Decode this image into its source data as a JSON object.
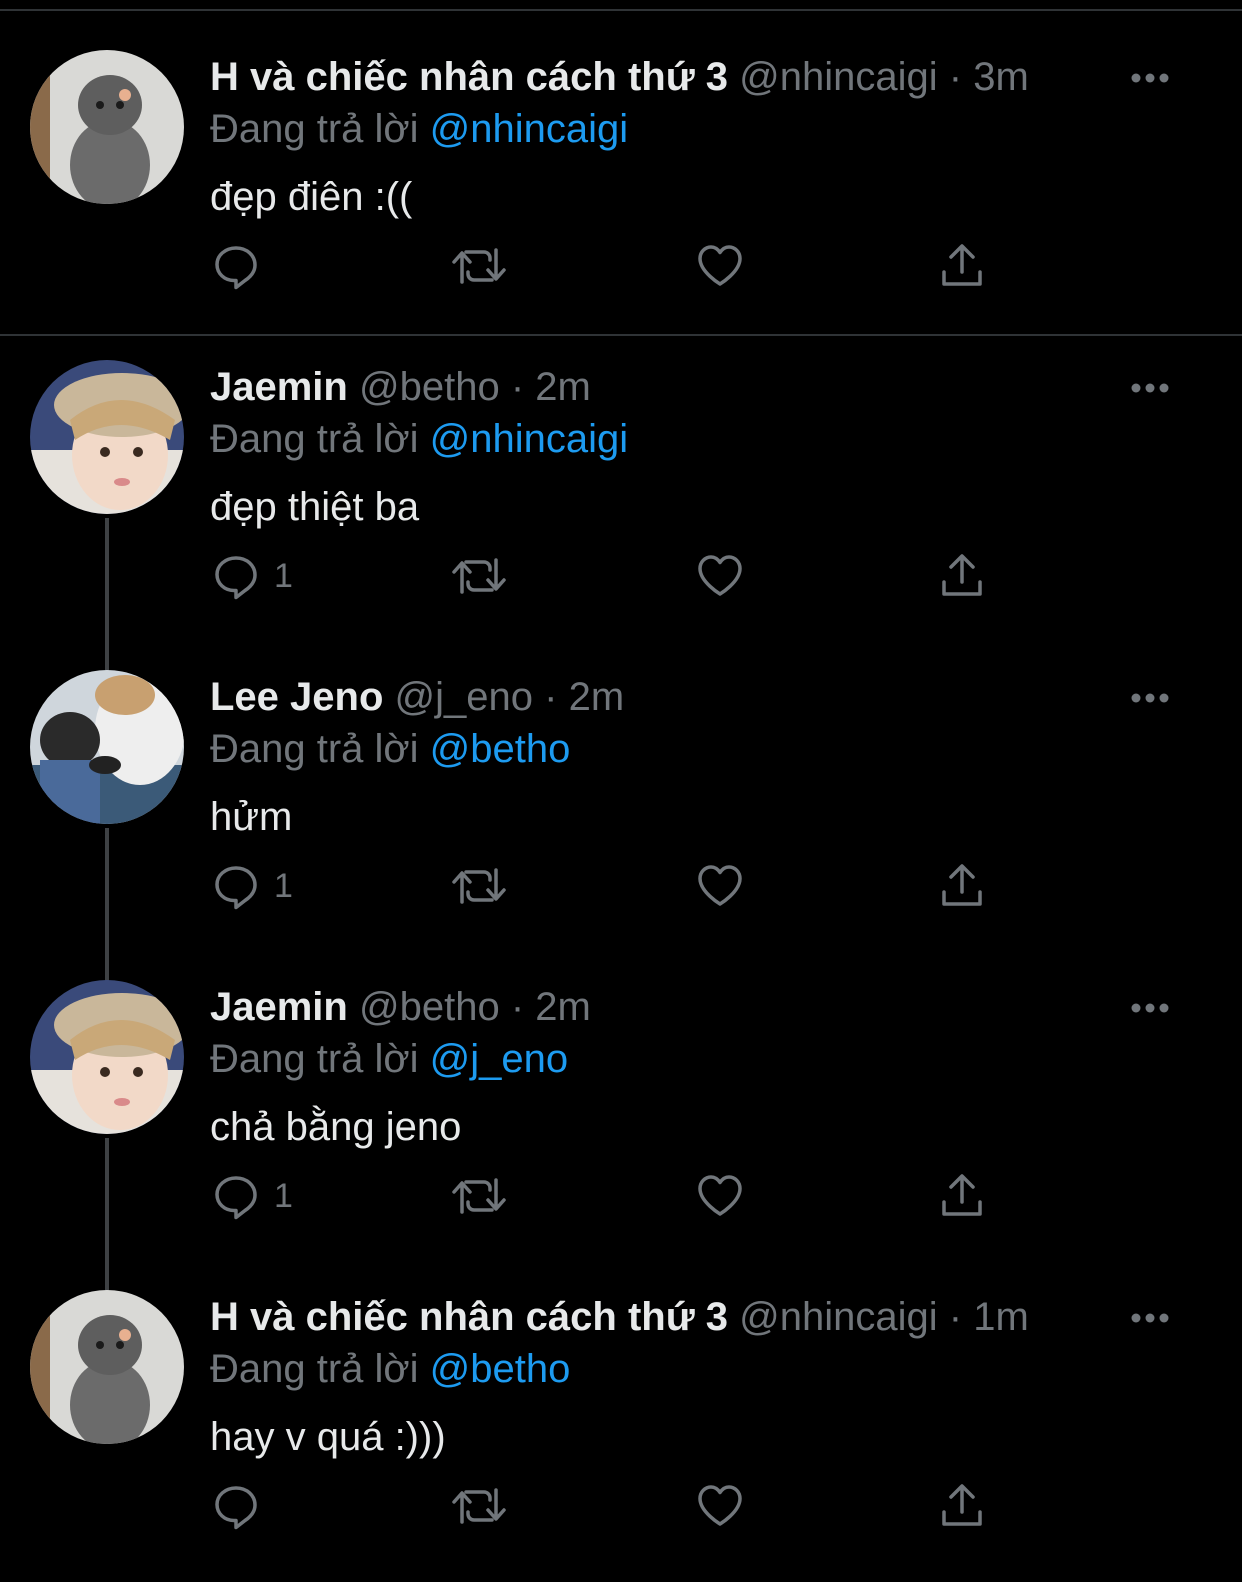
{
  "reply_prefix": "Đang trả lời",
  "separator": "·",
  "icons": {
    "more": "more-horizontal-icon",
    "reply": "reply-bubble-icon",
    "retweet": "retweet-icon",
    "like": "heart-icon",
    "share": "share-upload-icon"
  },
  "colors": {
    "background": "#000000",
    "primary_text": "#e7e9ea",
    "secondary_text": "#71767b",
    "mention": "#1d9bf0",
    "divider": "#2f3336"
  },
  "tweets": [
    {
      "display_name": "H và chiếc nhân cách thứ 3",
      "handle": "@nhincaigi",
      "time": "3m",
      "replying_to": "@nhincaigi",
      "text": "đẹp điên :((",
      "reply_count": ""
    },
    {
      "display_name": "Jaemin",
      "handle": "@betho",
      "time": "2m",
      "replying_to": "@nhincaigi",
      "text": "đẹp thiệt ba",
      "reply_count": "1"
    },
    {
      "display_name": "Lee Jeno",
      "handle": "@j_eno",
      "time": "2m",
      "replying_to": "@betho",
      "text": "hửm",
      "reply_count": "1"
    },
    {
      "display_name": "Jaemin",
      "handle": "@betho",
      "time": "2m",
      "replying_to": "@j_eno",
      "text": "chả bằng jeno",
      "reply_count": "1"
    },
    {
      "display_name": "H và chiếc nhân cách thứ 3",
      "handle": "@nhincaigi",
      "time": "1m",
      "replying_to": "@betho",
      "text": "hay v quá :)))",
      "reply_count": ""
    }
  ]
}
